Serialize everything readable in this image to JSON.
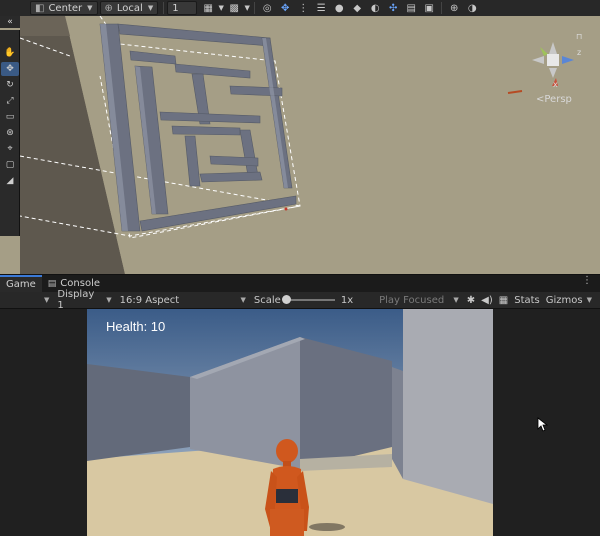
{
  "scene_toolbar": {
    "pivot_label": "Center",
    "space_label": "Local",
    "grid_value": "1",
    "icons": [
      "grid-snap-icon",
      "increment-snap-icon",
      "draw-mode-icon",
      "move-gizmo-icon",
      "hierarchy-icon",
      "view-options-icon",
      "shading-sphere-icon",
      "effects-icon",
      "hidden-objects-icon",
      "gizmo-toggle-icon",
      "tools-icon",
      "camera-icon",
      "global-sphere-icon",
      "render-sphere-icon"
    ]
  },
  "scene_view": {
    "persp_label": "<Persp",
    "axis_labels": {
      "x": "x",
      "z": "z"
    },
    "tools": [
      "hand-tool-icon",
      "move-tool-icon",
      "rotate-tool-icon",
      "scale-tool-icon",
      "rect-tool-icon",
      "transform-tool-icon",
      "custom-tool-icon",
      "collider-tool-icon",
      "terrain-tool-icon"
    ]
  },
  "tabs": [
    {
      "label": "Game",
      "active": true
    },
    {
      "label": "Console",
      "active": false
    }
  ],
  "game_toolbar": {
    "display_label": "Display 1",
    "aspect_label": "16:9 Aspect",
    "scale_label": "Scale",
    "scale_value": "1x",
    "scale_fraction": 0.0,
    "play_mode_label": "Play Focused",
    "stats_label": "Stats",
    "gizmos_label": "Gizmos"
  },
  "game_view": {
    "health_text": "Health: 10"
  },
  "colors": {
    "scene_ground": "#a59e86",
    "maze_wall": "#6e7384",
    "sky": "#3a5a86",
    "sand": "#d8c8a2",
    "character": "#d0581e",
    "accent_tab": "#3a79d7"
  }
}
